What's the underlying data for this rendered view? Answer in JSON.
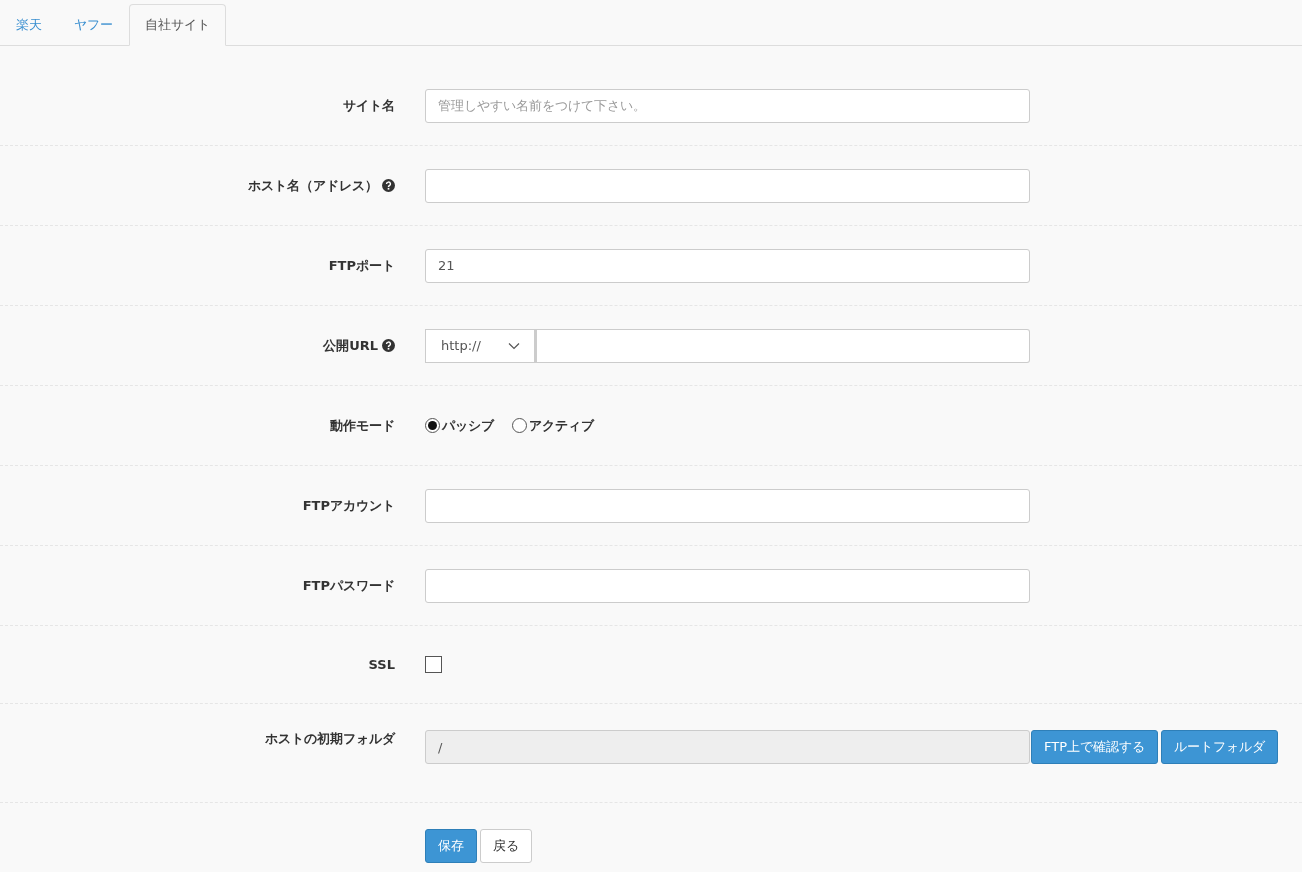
{
  "tabs": [
    {
      "label": "楽天",
      "selected": false
    },
    {
      "label": "ヤフー",
      "selected": false
    },
    {
      "label": "自社サイト",
      "selected": true
    }
  ],
  "form": {
    "rows": [
      {
        "kind": "text",
        "label": "サイト名",
        "help": false,
        "placeholder": "管理しやすい名前をつけて下さい。"
      },
      {
        "kind": "text",
        "label": "ホスト名（アドレス）",
        "help": true
      },
      {
        "kind": "text",
        "label": "FTPポート",
        "help": false,
        "value": "21"
      },
      {
        "kind": "url",
        "label": "公開URL",
        "help": true,
        "scheme": "http://"
      },
      {
        "kind": "radio",
        "label": "動作モード",
        "help": false,
        "options": [
          {
            "label": "パッシブ",
            "selected": true
          },
          {
            "label": "アクティブ",
            "selected": false
          }
        ]
      },
      {
        "kind": "text",
        "label": "FTPアカウント",
        "help": false
      },
      {
        "kind": "text",
        "label": "FTPパスワード",
        "help": false
      },
      {
        "kind": "checkbox",
        "label": "SSL",
        "help": false,
        "checked": false
      },
      {
        "kind": "folder",
        "label": "ホストの初期フォルダ",
        "help": false,
        "value": "/",
        "disabled": true,
        "buttons": [
          "FTP上で確認する",
          "ルートフォルダ"
        ]
      }
    ],
    "buttons": [
      {
        "label": "保存",
        "primary": true
      },
      {
        "label": "戻る",
        "primary": false
      }
    ]
  }
}
